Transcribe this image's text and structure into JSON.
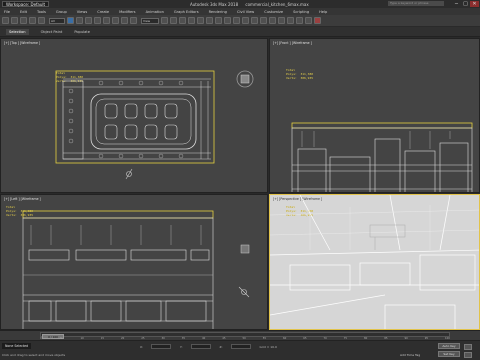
{
  "titlebar": {
    "workspace": "Workspace: Default",
    "app": "Autodesk 3ds Max 2018",
    "file": "commercial_kitchen_6max.max",
    "search_placeholder": "Type a keyword or phrase",
    "min": "−",
    "max": "□",
    "close": "✕"
  },
  "menu": [
    "File",
    "Edit",
    "Tools",
    "Group",
    "Views",
    "Create",
    "Modifiers",
    "Animation",
    "Graph Editors",
    "Rendering",
    "Civil View",
    "Customize",
    "Scripting",
    "Help"
  ],
  "toolbar": {
    "selection_filter": "All",
    "view_mode": "View"
  },
  "ribbon": {
    "items": [
      "Selection",
      "Object Paint",
      "Populate"
    ]
  },
  "viewports": {
    "top": {
      "label": "[+] [Top ] [Wireframe ]",
      "stats": "Total\nPolys:  311,380\nVerts:  306,935"
    },
    "front": {
      "label": "[+] [Front ] [Wireframe ]",
      "stats": "Total\nPolys:  311,380\nVerts:  306,935"
    },
    "left": {
      "label": "[+] [Left ] [Wireframe ]",
      "stats": "Total\nPolys:  311,380\nVerts:  306,935"
    },
    "perspective": {
      "label": "[+] [Perspective ] [Wireframe ]",
      "stats": "Total\nPolys:  311,380\nVerts:  306,935"
    }
  },
  "timeline": {
    "slider": "0 / 100",
    "ticks": [
      "0",
      "5",
      "10",
      "15",
      "20",
      "25",
      "30",
      "35",
      "40",
      "45",
      "50",
      "55",
      "60",
      "65",
      "70",
      "75",
      "80",
      "85",
      "90",
      "95",
      "100"
    ]
  },
  "status": {
    "selection": "None Selected",
    "prompt": "Click and drag to select and move objects",
    "x_label": "X:",
    "y_label": "Y:",
    "z_label": "Z:",
    "grid": "Grid = 10.0",
    "add_time_tag": "Add Time Tag",
    "auto_key": "Auto Key",
    "set_key": "Set Key"
  }
}
